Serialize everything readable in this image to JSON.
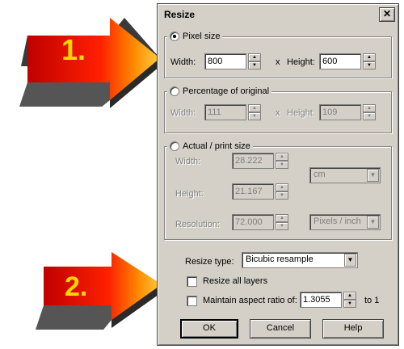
{
  "dialog": {
    "title": "Resize",
    "close_label": "✕"
  },
  "annotations": {
    "step1": "1.",
    "step2": "2."
  },
  "pixel_size": {
    "label": "Pixel size",
    "selected": true,
    "width_label": "Width:",
    "width_value": "800",
    "x_label": "x",
    "height_label": "Height:",
    "height_value": "600"
  },
  "percentage": {
    "label": "Percentage of original",
    "selected": false,
    "width_label": "Width:",
    "width_value": "111",
    "x_label": "x",
    "height_label": "Height:",
    "height_value": "109"
  },
  "print_size": {
    "label": "Actual / print size",
    "selected": false,
    "width_label": "Width:",
    "width_value": "28.222",
    "height_label": "Height:",
    "height_value": "21.167",
    "resolution_label": "Resolution:",
    "resolution_value": "72.000",
    "unit_value": "cm",
    "res_unit_value": "Pixels / inch"
  },
  "resize_type": {
    "label": "Resize type:",
    "value": "Bicubic resample"
  },
  "options": {
    "resize_all_layers": "Resize all layers",
    "resize_all_layers_checked": false,
    "maintain_aspect": "Maintain aspect ratio of:",
    "maintain_aspect_checked": false,
    "aspect_value": "1.3055",
    "to_one": "to 1"
  },
  "buttons": {
    "ok": "OK",
    "cancel": "Cancel",
    "help": "Help"
  },
  "colors": {
    "arrow_red": "#e00000",
    "arrow_yellow": "#ffc000",
    "dialog_bg": "#d4d0c8"
  }
}
